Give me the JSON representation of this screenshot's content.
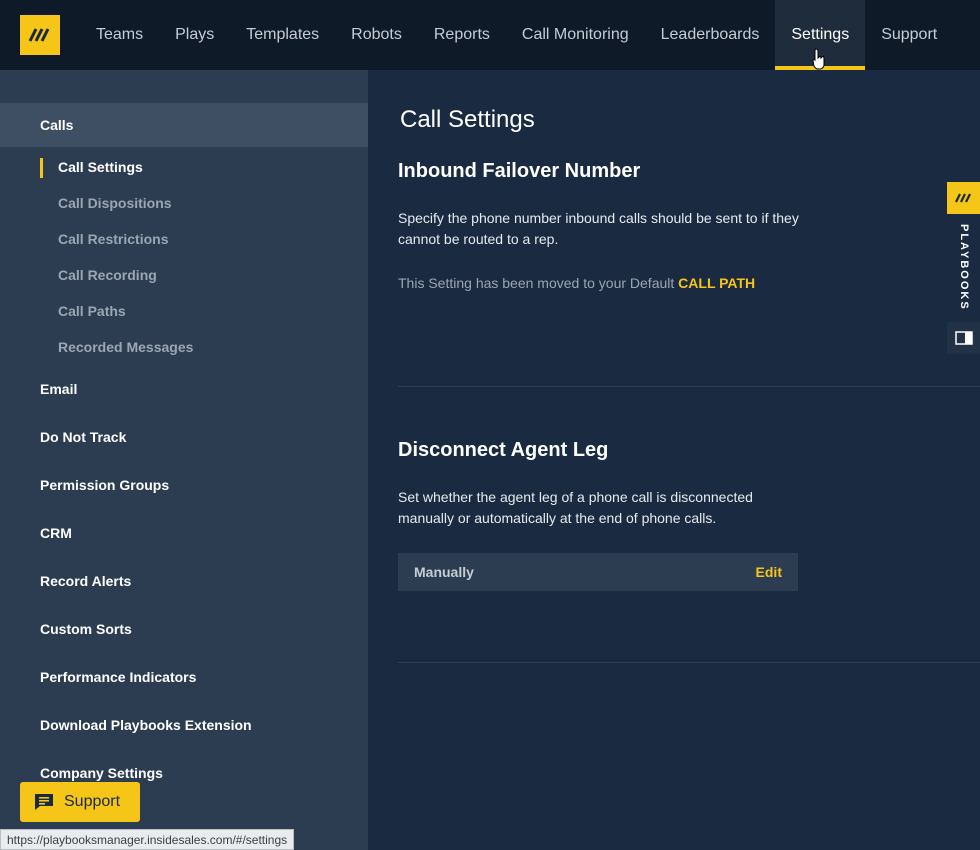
{
  "nav": {
    "items": [
      "Teams",
      "Plays",
      "Templates",
      "Robots",
      "Reports",
      "Call Monitoring",
      "Leaderboards",
      "Settings",
      "Support"
    ],
    "active": "Settings"
  },
  "sidebar": {
    "sections": [
      {
        "label": "Calls",
        "active": true
      },
      {
        "label": "Email"
      },
      {
        "label": "Do Not Track"
      },
      {
        "label": "Permission Groups"
      },
      {
        "label": "CRM"
      },
      {
        "label": "Record Alerts"
      },
      {
        "label": "Custom Sorts"
      },
      {
        "label": "Performance Indicators"
      },
      {
        "label": "Download Playbooks Extension"
      },
      {
        "label": "Company Settings"
      }
    ],
    "calls_subitems": [
      {
        "label": "Call Settings",
        "active": true
      },
      {
        "label": "Call Dispositions"
      },
      {
        "label": "Call Restrictions"
      },
      {
        "label": "Call Recording"
      },
      {
        "label": "Call Paths"
      },
      {
        "label": "Recorded Messages"
      }
    ]
  },
  "main": {
    "title": "Call Settings",
    "inbound": {
      "title": "Inbound Failover Number",
      "description": "Specify the phone number inbound calls should be sent to if they cannot be routed to a rep.",
      "moved_note": "This Setting has been moved to your Default",
      "link": "CALL PATH"
    },
    "disconnect": {
      "title": "Disconnect Agent Leg",
      "description": "Set whether the agent leg of a phone call is disconnected manually or automatically at the end of phone calls.",
      "value": "Manually",
      "edit_label": "Edit"
    }
  },
  "playbooks_tab": {
    "label": "PLAYBOOKS"
  },
  "support_button": {
    "label": "Support"
  },
  "status_url": "https://playbooksmanager.insidesales.com/#/settings",
  "colors": {
    "accent": "#f5c518",
    "topbar": "#0f1a28",
    "sidebar": "#2c3d52",
    "main": "#1a2a40"
  }
}
